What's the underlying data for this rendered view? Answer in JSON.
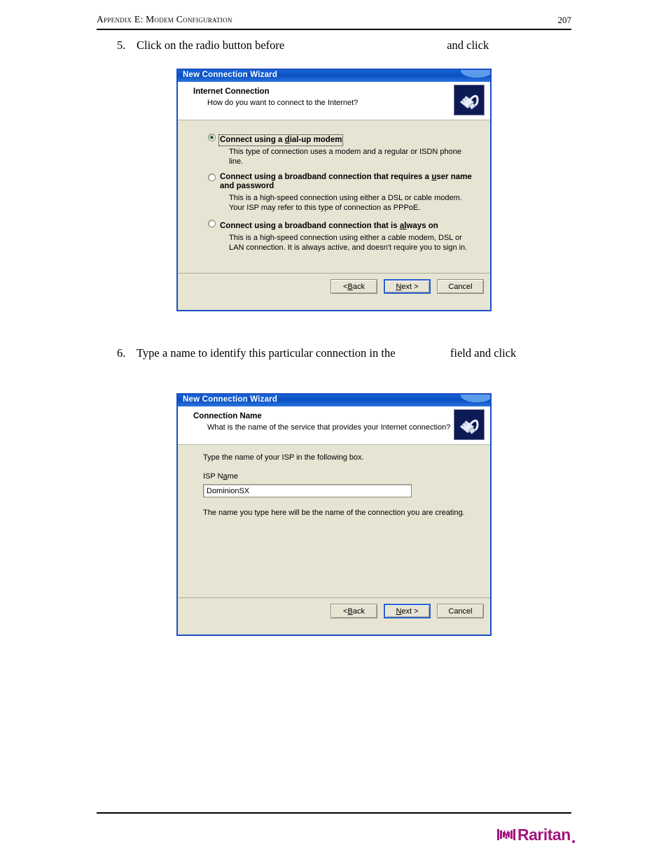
{
  "page": {
    "header_title": "Appendix E: Modem Configuration",
    "page_number": "207"
  },
  "steps": [
    {
      "number": "5.",
      "text_before": "Click on the radio button before",
      "hidden_term": "Connect using a dial-up modem",
      "text_after": "and click",
      "hidden_button": "Next"
    },
    {
      "number": "6.",
      "text_before": "Type a name to identify this particular connection in the",
      "hidden_term": "ISP Name",
      "text_after": "field and click",
      "hidden_button": "Next"
    }
  ],
  "wizard1": {
    "title": "New Connection Wizard",
    "head_title": "Internet Connection",
    "head_subtitle": "How do you want to connect to the Internet?",
    "icon": "network-plug-icon",
    "options": [
      {
        "label_pre": "Connect using a ",
        "label_accel": "d",
        "label_post": "ial-up modem",
        "label_full": "Connect using a dial-up modem",
        "selected": true,
        "focused": true,
        "description": "This type of connection uses a modem and a regular or ISDN phone line."
      },
      {
        "label_pre": "Connect using a broadband connection that requires a ",
        "label_accel": "u",
        "label_post": "ser name and password",
        "label_full": "Connect using a broadband connection that requires a user name and password",
        "selected": false,
        "focused": false,
        "description": "This is a high-speed connection using either a DSL or cable modem. Your ISP may refer to this type of connection as PPPoE."
      },
      {
        "label_pre": "Connect using a broadband connection that is ",
        "label_accel": "al",
        "label_post": "ways on",
        "label_full": "Connect using a broadband connection that is always on",
        "selected": false,
        "focused": false,
        "description": "This is a high-speed connection using either a cable modem, DSL or LAN connection. It is always active, and doesn't require you to sign in."
      }
    ],
    "buttons": {
      "back_pre": "< ",
      "back_accel": "B",
      "back_post": "ack",
      "back_full": "< Back",
      "next_accel": "N",
      "next_post": "ext >",
      "next_full": "Next >",
      "cancel": "Cancel"
    }
  },
  "wizard2": {
    "title": "New Connection Wizard",
    "head_title": "Connection Name",
    "head_subtitle": "What is the name of the service that provides your Internet connection?",
    "icon": "network-plug-icon",
    "instruction": "Type the name of your ISP in the following box.",
    "field_label_pre": "ISP N",
    "field_label_accel": "a",
    "field_label_post": "me",
    "field_label_full": "ISP Name",
    "field_value": "DominionSX",
    "field_placeholder": "",
    "note": "The name you type here will be the name of the connection you are creating.",
    "buttons": {
      "back_pre": "< ",
      "back_accel": "B",
      "back_post": "ack",
      "back_full": "< Back",
      "next_accel": "N",
      "next_post": "ext >",
      "next_full": "Next >",
      "cancel": "Cancel"
    }
  },
  "footer": {
    "logo_text": "Raritan",
    "logo_color": "#a3157e"
  }
}
